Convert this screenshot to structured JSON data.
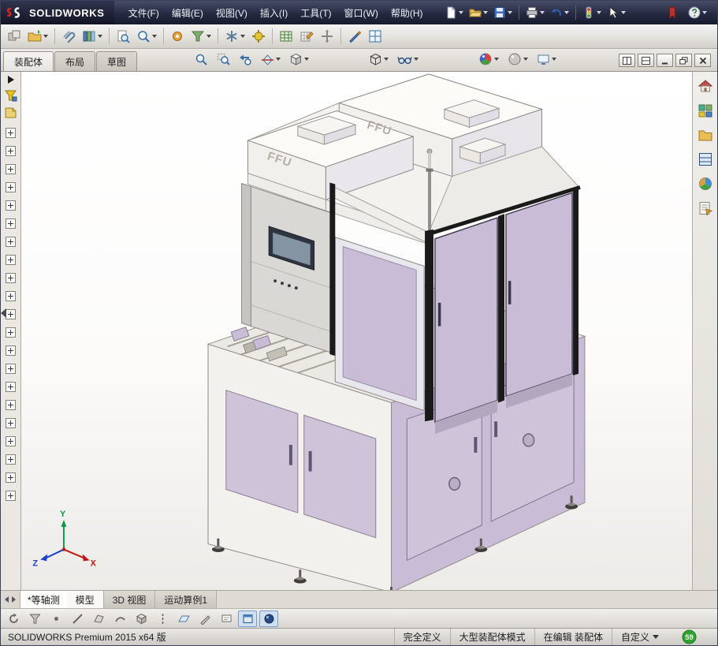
{
  "app": {
    "brand": "SOLIDWORKS"
  },
  "menubar": {
    "items": [
      "文件(F)",
      "编辑(E)",
      "视图(V)",
      "插入(I)",
      "工具(T)",
      "窗口(W)",
      "帮助(H)"
    ]
  },
  "command_manager": {
    "tabs": [
      {
        "label": "装配体",
        "active": true
      },
      {
        "label": "布局",
        "active": false
      },
      {
        "label": "草图",
        "active": false
      }
    ]
  },
  "viewport": {
    "view_name": "*等轴测",
    "model_label": "FFU",
    "triad": {
      "x": "X",
      "y": "Y",
      "z": "Z"
    }
  },
  "doc_tabs": {
    "items": [
      {
        "label": "模型",
        "active": true
      },
      {
        "label": "3D 视图",
        "active": false
      },
      {
        "label": "运动算例1",
        "active": false
      }
    ]
  },
  "statusbar": {
    "version_text": "SOLIDWORKS Premium 2015 x64 版",
    "definition_state": "完全定义",
    "large_assembly_mode": "大型装配体模式",
    "edit_state": "在编辑 装配体",
    "customize": "自定义",
    "notification_count": "59"
  },
  "colors": {
    "lavender_panel": "#c9bcd6",
    "lavender_light": "#cfc3da",
    "frame_black": "#1a1a1a",
    "machine_white": "#f3f1ed",
    "triad_x": "#c01818",
    "triad_y": "#0a9a48",
    "triad_z": "#2040c8",
    "notification_green": "#2fa12f"
  },
  "icons": [
    "ds-logo",
    "new-document",
    "open",
    "save",
    "print",
    "undo",
    "rebuild",
    "select-pointer",
    "bookmark",
    "help",
    "zoom-fit",
    "zoom-area",
    "previous-view",
    "section-view",
    "view-orientation",
    "display-style",
    "hide-show-items",
    "edit-appearance",
    "apply-scene",
    "view-settings",
    "solidworks-resources",
    "design-library",
    "file-explorer",
    "view-palette",
    "appearances-scenes",
    "custom-properties",
    "feature-tree-filter",
    "design-binder"
  ]
}
